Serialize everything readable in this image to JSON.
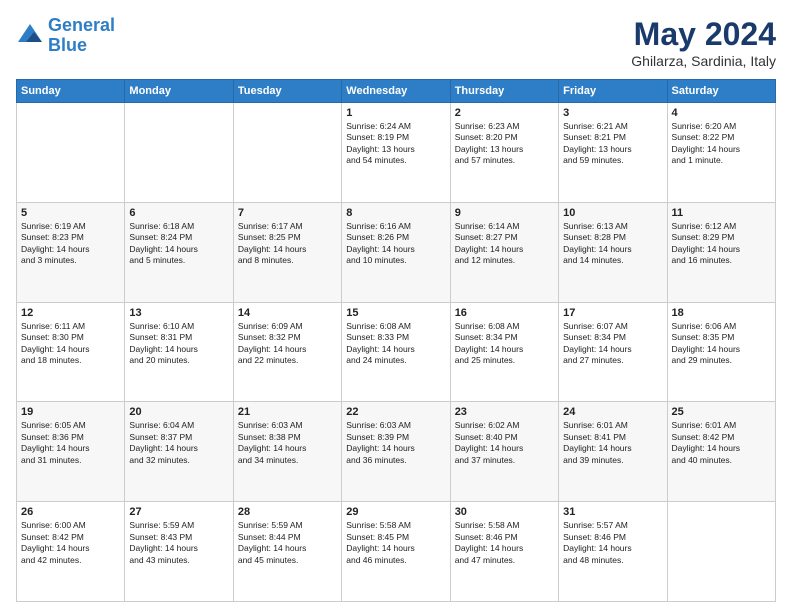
{
  "header": {
    "logo_line1": "General",
    "logo_line2": "Blue",
    "month_title": "May 2024",
    "location": "Ghilarza, Sardinia, Italy"
  },
  "weekdays": [
    "Sunday",
    "Monday",
    "Tuesday",
    "Wednesday",
    "Thursday",
    "Friday",
    "Saturday"
  ],
  "weeks": [
    [
      {
        "day": "",
        "info": ""
      },
      {
        "day": "",
        "info": ""
      },
      {
        "day": "",
        "info": ""
      },
      {
        "day": "1",
        "info": "Sunrise: 6:24 AM\nSunset: 8:19 PM\nDaylight: 13 hours\nand 54 minutes."
      },
      {
        "day": "2",
        "info": "Sunrise: 6:23 AM\nSunset: 8:20 PM\nDaylight: 13 hours\nand 57 minutes."
      },
      {
        "day": "3",
        "info": "Sunrise: 6:21 AM\nSunset: 8:21 PM\nDaylight: 13 hours\nand 59 minutes."
      },
      {
        "day": "4",
        "info": "Sunrise: 6:20 AM\nSunset: 8:22 PM\nDaylight: 14 hours\nand 1 minute."
      }
    ],
    [
      {
        "day": "5",
        "info": "Sunrise: 6:19 AM\nSunset: 8:23 PM\nDaylight: 14 hours\nand 3 minutes."
      },
      {
        "day": "6",
        "info": "Sunrise: 6:18 AM\nSunset: 8:24 PM\nDaylight: 14 hours\nand 5 minutes."
      },
      {
        "day": "7",
        "info": "Sunrise: 6:17 AM\nSunset: 8:25 PM\nDaylight: 14 hours\nand 8 minutes."
      },
      {
        "day": "8",
        "info": "Sunrise: 6:16 AM\nSunset: 8:26 PM\nDaylight: 14 hours\nand 10 minutes."
      },
      {
        "day": "9",
        "info": "Sunrise: 6:14 AM\nSunset: 8:27 PM\nDaylight: 14 hours\nand 12 minutes."
      },
      {
        "day": "10",
        "info": "Sunrise: 6:13 AM\nSunset: 8:28 PM\nDaylight: 14 hours\nand 14 minutes."
      },
      {
        "day": "11",
        "info": "Sunrise: 6:12 AM\nSunset: 8:29 PM\nDaylight: 14 hours\nand 16 minutes."
      }
    ],
    [
      {
        "day": "12",
        "info": "Sunrise: 6:11 AM\nSunset: 8:30 PM\nDaylight: 14 hours\nand 18 minutes."
      },
      {
        "day": "13",
        "info": "Sunrise: 6:10 AM\nSunset: 8:31 PM\nDaylight: 14 hours\nand 20 minutes."
      },
      {
        "day": "14",
        "info": "Sunrise: 6:09 AM\nSunset: 8:32 PM\nDaylight: 14 hours\nand 22 minutes."
      },
      {
        "day": "15",
        "info": "Sunrise: 6:08 AM\nSunset: 8:33 PM\nDaylight: 14 hours\nand 24 minutes."
      },
      {
        "day": "16",
        "info": "Sunrise: 6:08 AM\nSunset: 8:34 PM\nDaylight: 14 hours\nand 25 minutes."
      },
      {
        "day": "17",
        "info": "Sunrise: 6:07 AM\nSunset: 8:34 PM\nDaylight: 14 hours\nand 27 minutes."
      },
      {
        "day": "18",
        "info": "Sunrise: 6:06 AM\nSunset: 8:35 PM\nDaylight: 14 hours\nand 29 minutes."
      }
    ],
    [
      {
        "day": "19",
        "info": "Sunrise: 6:05 AM\nSunset: 8:36 PM\nDaylight: 14 hours\nand 31 minutes."
      },
      {
        "day": "20",
        "info": "Sunrise: 6:04 AM\nSunset: 8:37 PM\nDaylight: 14 hours\nand 32 minutes."
      },
      {
        "day": "21",
        "info": "Sunrise: 6:03 AM\nSunset: 8:38 PM\nDaylight: 14 hours\nand 34 minutes."
      },
      {
        "day": "22",
        "info": "Sunrise: 6:03 AM\nSunset: 8:39 PM\nDaylight: 14 hours\nand 36 minutes."
      },
      {
        "day": "23",
        "info": "Sunrise: 6:02 AM\nSunset: 8:40 PM\nDaylight: 14 hours\nand 37 minutes."
      },
      {
        "day": "24",
        "info": "Sunrise: 6:01 AM\nSunset: 8:41 PM\nDaylight: 14 hours\nand 39 minutes."
      },
      {
        "day": "25",
        "info": "Sunrise: 6:01 AM\nSunset: 8:42 PM\nDaylight: 14 hours\nand 40 minutes."
      }
    ],
    [
      {
        "day": "26",
        "info": "Sunrise: 6:00 AM\nSunset: 8:42 PM\nDaylight: 14 hours\nand 42 minutes."
      },
      {
        "day": "27",
        "info": "Sunrise: 5:59 AM\nSunset: 8:43 PM\nDaylight: 14 hours\nand 43 minutes."
      },
      {
        "day": "28",
        "info": "Sunrise: 5:59 AM\nSunset: 8:44 PM\nDaylight: 14 hours\nand 45 minutes."
      },
      {
        "day": "29",
        "info": "Sunrise: 5:58 AM\nSunset: 8:45 PM\nDaylight: 14 hours\nand 46 minutes."
      },
      {
        "day": "30",
        "info": "Sunrise: 5:58 AM\nSunset: 8:46 PM\nDaylight: 14 hours\nand 47 minutes."
      },
      {
        "day": "31",
        "info": "Sunrise: 5:57 AM\nSunset: 8:46 PM\nDaylight: 14 hours\nand 48 minutes."
      },
      {
        "day": "",
        "info": ""
      }
    ]
  ]
}
